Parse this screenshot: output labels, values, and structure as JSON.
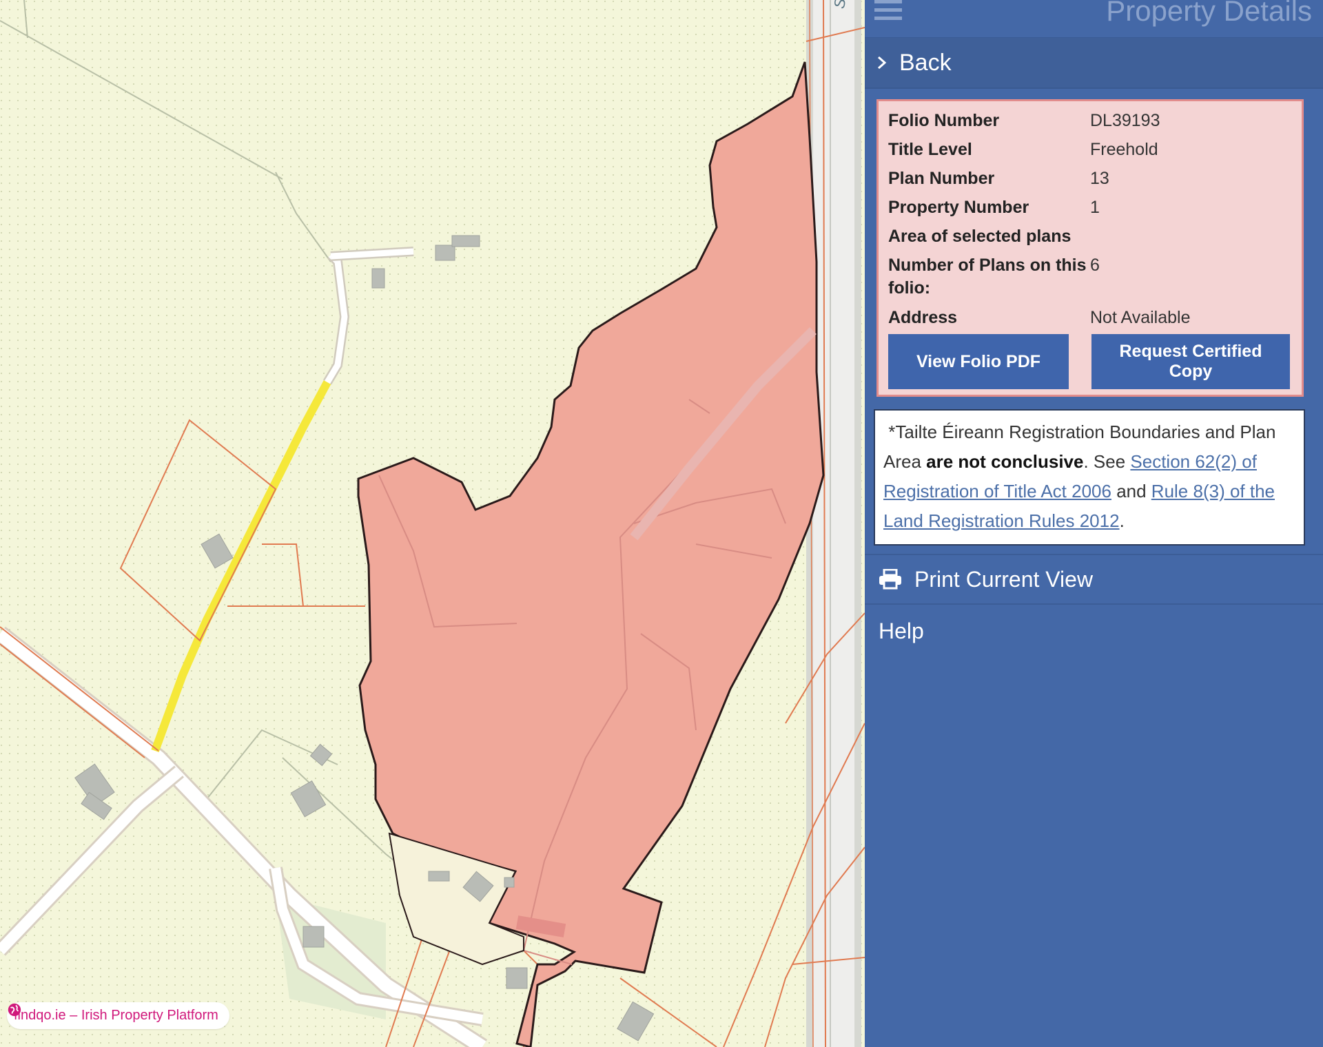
{
  "map": {
    "road_label": "Slí an Atlantaigh F",
    "watermark": "findqo.ie – Irish Property Platform",
    "colors": {
      "background": "#f4f6da",
      "parcel_fill": "#f0a89a",
      "parcel_stroke": "#2a1a1a",
      "boundary": "#e07a50",
      "highlight_road": "#f5e83a",
      "road": "#ffffff"
    }
  },
  "panel": {
    "title": "Property Details",
    "back_label": "Back",
    "details": {
      "rows": [
        {
          "label": "Folio Number",
          "value": "DL39193"
        },
        {
          "label": "Title Level",
          "value": "Freehold"
        },
        {
          "label": "Plan Number",
          "value": "13"
        },
        {
          "label": "Property Number",
          "value": "1"
        },
        {
          "label": "Area of selected plans",
          "value": ""
        },
        {
          "label": "Number of Plans on this folio:",
          "value": "6"
        },
        {
          "label": "Address",
          "value": "Not Available"
        }
      ],
      "view_pdf_label": "View Folio PDF",
      "certified_copy_label": "Request Certified Copy"
    },
    "notice": {
      "part1": "*Tailte Éireann Registration Boundaries and Plan Area ",
      "bold": "are not conclusive",
      "part2": ". See ",
      "link1": "Section 62(2) of Registration of Title Act 2006",
      "part3": " and ",
      "link2": "Rule 8(3) of the Land Registration Rules 2012",
      "part4": "."
    },
    "print_label": "Print Current View",
    "help_label": "Help",
    "colors": {
      "panel_bg": "#4468a7",
      "details_bg": "#f4d4d4",
      "details_border": "#e28c8c",
      "button_bg": "#3f65ac"
    }
  }
}
